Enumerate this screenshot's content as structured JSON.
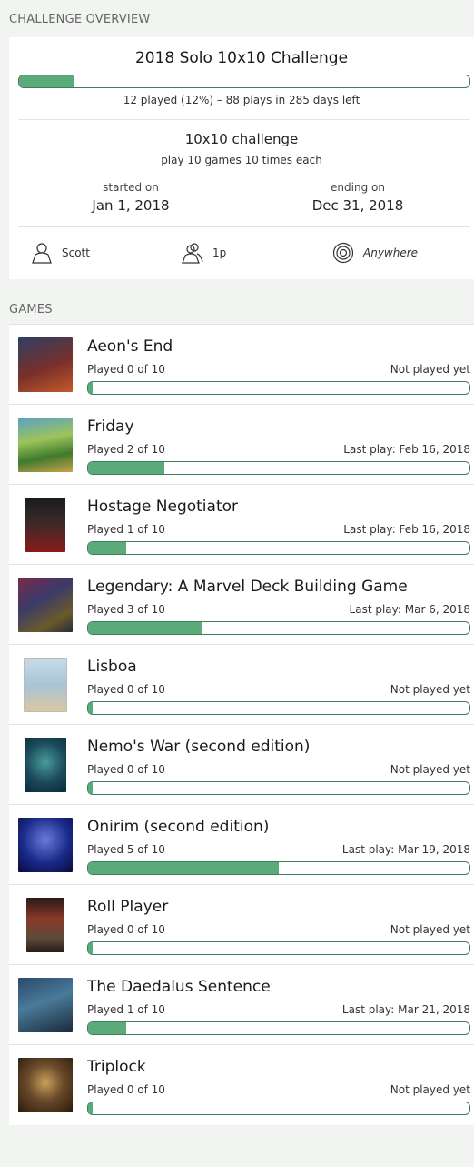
{
  "overview": {
    "header": "CHALLENGE OVERVIEW",
    "title": "2018 Solo 10x10 Challenge",
    "progress": 0.12,
    "summary": "12 played (12%) – 88 plays in 285 days left",
    "challenge_name": "10x10 challenge",
    "challenge_desc": "play 10 games 10 times each",
    "start_label": "started on",
    "start_date": "Jan 1, 2018",
    "end_label": "ending on",
    "end_date": "Dec 31, 2018",
    "player": "Scott",
    "player_count": "1p",
    "location": "Anywhere",
    "icons": [
      "person-icon",
      "players-icon",
      "location-target-icon"
    ],
    "accent_color": "#5aaa7a",
    "border_color": "#3d7f59"
  },
  "games": {
    "header": "GAMES",
    "items": [
      {
        "name": "Aeon's End",
        "played": "Played 0 of 10",
        "last": "Not played yet",
        "progress": 0.0
      },
      {
        "name": "Friday",
        "played": "Played 2 of 10",
        "last": "Last play: Feb 16, 2018",
        "progress": 0.2
      },
      {
        "name": "Hostage Negotiator",
        "played": "Played 1 of 10",
        "last": "Last play: Feb 16, 2018",
        "progress": 0.1
      },
      {
        "name": "Legendary: A Marvel Deck Building Game",
        "played": "Played 3 of 10",
        "last": "Last play: Mar 6, 2018",
        "progress": 0.3
      },
      {
        "name": "Lisboa",
        "played": "Played 0 of 10",
        "last": "Not played yet",
        "progress": 0.0
      },
      {
        "name": "Nemo's War (second edition)",
        "played": "Played 0 of 10",
        "last": "Not played yet",
        "progress": 0.0
      },
      {
        "name": "Onirim (second edition)",
        "played": "Played 5 of 10",
        "last": "Last play: Mar 19, 2018",
        "progress": 0.5
      },
      {
        "name": "Roll Player",
        "played": "Played 0 of 10",
        "last": "Not played yet",
        "progress": 0.0
      },
      {
        "name": "The Daedalus Sentence",
        "played": "Played 1 of 10",
        "last": "Last play: Mar 21, 2018",
        "progress": 0.1
      },
      {
        "name": "Triplock",
        "played": "Played 0 of 10",
        "last": "Not played yet",
        "progress": 0.0
      }
    ]
  }
}
